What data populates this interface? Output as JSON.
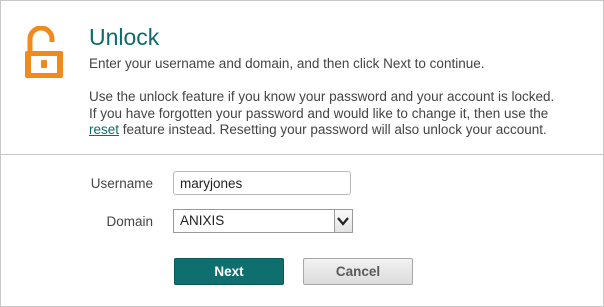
{
  "colors": {
    "accent": "#0d6b6b",
    "lock_icon": "#f08a1c",
    "next_button_bg": "#0f6e6e"
  },
  "header": {
    "icon": "unlocked-padlock-icon",
    "title": "Unlock",
    "subtitle": "Enter your username and domain, and then click Next to continue."
  },
  "description": {
    "line1": "Use the unlock feature if you know your password and your account is locked.",
    "line2": "If you have forgotten your password and would like to change it, then use the",
    "link": "reset",
    "line3_rest": " feature instead. Resetting your password will also unlock your account."
  },
  "form": {
    "username_label": "Username",
    "username_value": "maryjones",
    "domain_label": "Domain",
    "domain_value": "ANIXIS",
    "domain_icon": "chevron-down-icon"
  },
  "buttons": {
    "next": "Next",
    "cancel": "Cancel"
  }
}
